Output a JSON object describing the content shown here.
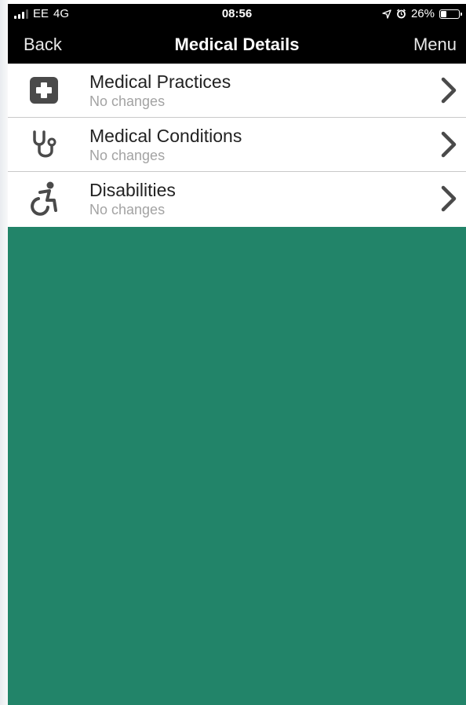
{
  "status_bar": {
    "carrier": "EE",
    "network": "4G",
    "time": "08:56",
    "battery": "26%",
    "battery_level": 0.26
  },
  "nav": {
    "back_label": "Back",
    "title": "Medical Details",
    "menu_label": "Menu"
  },
  "items": [
    {
      "title": "Medical Practices",
      "subtitle": "No changes",
      "icon": "medical-cross-icon"
    },
    {
      "title": "Medical Conditions",
      "subtitle": "No changes",
      "icon": "stethoscope-icon"
    },
    {
      "title": "Disabilities",
      "subtitle": "No changes",
      "icon": "wheelchair-icon"
    }
  ],
  "colors": {
    "background": "#228469",
    "bar": "#000000",
    "icon": "#4a4a4a",
    "subtitle": "#a3a3a3"
  }
}
